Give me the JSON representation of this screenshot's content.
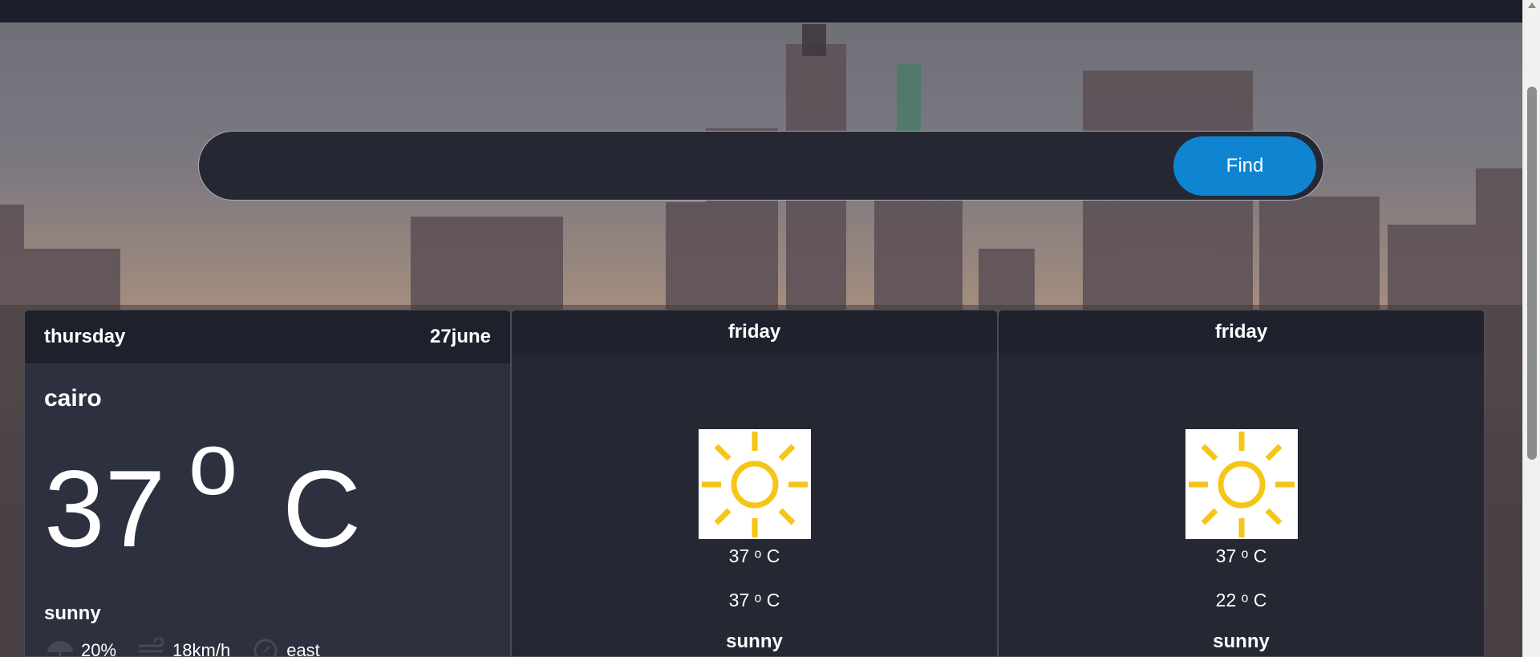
{
  "search": {
    "placeholder": "",
    "value": "",
    "button_label": "Find"
  },
  "today": {
    "day": "thursday",
    "date": "27june",
    "city": "cairo",
    "temp_value": "37",
    "temp_degree": "o",
    "temp_unit": "C",
    "condition": "sunny",
    "rain": "20%",
    "wind": "18km/h",
    "direction": "east"
  },
  "forecast": [
    {
      "day": "friday",
      "max_temp": "37 ᵒ C",
      "min_temp": "37 ᵒ C",
      "condition": "sunny",
      "icon": "sun-icon"
    },
    {
      "day": "friday",
      "max_temp": "37 ᵒ C",
      "min_temp": "22 ᵒ C",
      "condition": "sunny",
      "icon": "sun-icon"
    }
  ],
  "colors": {
    "accent": "#0f85d2",
    "card_today": "#2d303e",
    "card_next": "#252733",
    "card_header": "#1e202b",
    "sun": "#f5c518"
  }
}
